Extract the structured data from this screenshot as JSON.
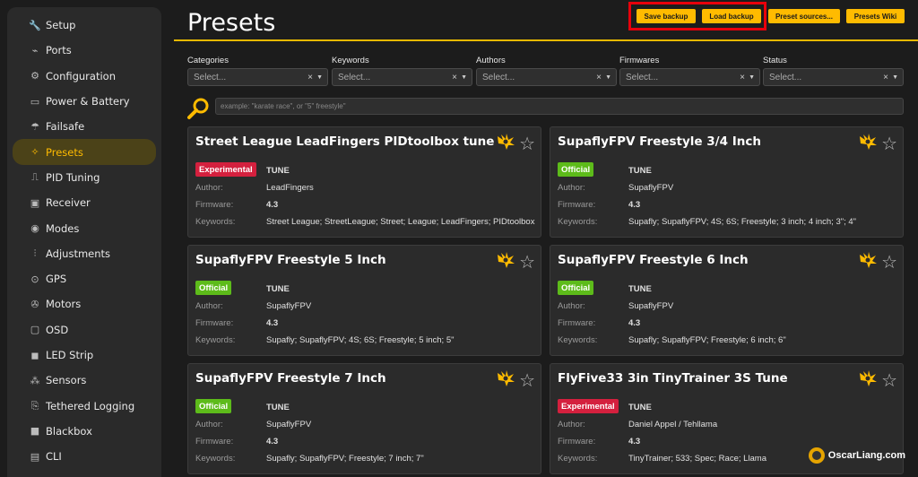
{
  "sidebar": {
    "items": [
      {
        "label": "Setup",
        "icon": "wrench-icon",
        "glyph": "🔧"
      },
      {
        "label": "Ports",
        "icon": "plug-icon",
        "glyph": "⌁"
      },
      {
        "label": "Configuration",
        "icon": "gear-icon",
        "glyph": "⚙"
      },
      {
        "label": "Power & Battery",
        "icon": "battery-icon",
        "glyph": "▭"
      },
      {
        "label": "Failsafe",
        "icon": "parachute-icon",
        "glyph": "☂"
      },
      {
        "label": "Presets",
        "icon": "magic-wand-icon",
        "glyph": "✧",
        "active": true
      },
      {
        "label": "PID Tuning",
        "icon": "pid-icon",
        "glyph": "⎍"
      },
      {
        "label": "Receiver",
        "icon": "receiver-icon",
        "glyph": "▣"
      },
      {
        "label": "Modes",
        "icon": "toggle-icon",
        "glyph": "◉"
      },
      {
        "label": "Adjustments",
        "icon": "sliders-icon",
        "glyph": "⫶"
      },
      {
        "label": "GPS",
        "icon": "location-pin-icon",
        "glyph": "⊙"
      },
      {
        "label": "Motors",
        "icon": "motor-icon",
        "glyph": "✇"
      },
      {
        "label": "OSD",
        "icon": "monitor-icon",
        "glyph": "▢"
      },
      {
        "label": "LED Strip",
        "icon": "led-icon",
        "glyph": "◼"
      },
      {
        "label": "Sensors",
        "icon": "sensor-icon",
        "glyph": "⁂"
      },
      {
        "label": "Tethered Logging",
        "icon": "cable-icon",
        "glyph": "⎘"
      },
      {
        "label": "Blackbox",
        "icon": "blackbox-icon",
        "glyph": "■"
      },
      {
        "label": "CLI",
        "icon": "terminal-icon",
        "glyph": "▤"
      }
    ]
  },
  "header": {
    "title": "Presets",
    "buttons": {
      "save_backup": "Save backup",
      "load_backup": "Load backup",
      "preset_sources": "Preset sources...",
      "presets_wiki": "Presets Wiki"
    }
  },
  "filters": [
    {
      "label": "Categories",
      "placeholder": "Select..."
    },
    {
      "label": "Keywords",
      "placeholder": "Select..."
    },
    {
      "label": "Authors",
      "placeholder": "Select..."
    },
    {
      "label": "Firmwares",
      "placeholder": "Select..."
    },
    {
      "label": "Status",
      "placeholder": "Select..."
    }
  ],
  "search": {
    "placeholder": "example: \"karate race\", or \"5\" freestyle\""
  },
  "labels": {
    "author": "Author:",
    "firmware": "Firmware:",
    "keywords": "Keywords:"
  },
  "cards": [
    {
      "title": "Street League LeadFingers PIDtoolbox tune",
      "status": "Experimental",
      "type": "TUNE",
      "author": "LeadFingers",
      "firmware": "4.3",
      "keywords": "Street League; StreetLeague; Street; League; LeadFingers; PIDtoolbox"
    },
    {
      "title": "SupaflyFPV Freestyle 3/4 Inch",
      "status": "Official",
      "type": "TUNE",
      "author": "SupaflyFPV",
      "firmware": "4.3",
      "keywords": "Supafly; SupaflyFPV; 4S; 6S; Freestyle; 3 inch; 4 inch; 3\"; 4\""
    },
    {
      "title": "SupaflyFPV Freestyle 5 Inch",
      "status": "Official",
      "type": "TUNE",
      "author": "SupaflyFPV",
      "firmware": "4.3",
      "keywords": "Supafly; SupaflyFPV; 4S; 6S; Freestyle; 5 inch; 5\""
    },
    {
      "title": "SupaflyFPV Freestyle 6 Inch",
      "status": "Official",
      "type": "TUNE",
      "author": "SupaflyFPV",
      "firmware": "4.3",
      "keywords": "Supafly; SupaflyFPV; Freestyle; 6 inch; 6\""
    },
    {
      "title": "SupaflyFPV Freestyle 7 Inch",
      "status": "Official",
      "type": "TUNE",
      "author": "SupaflyFPV",
      "firmware": "4.3",
      "keywords": "Supafly; SupaflyFPV; Freestyle; 7 inch; 7\""
    },
    {
      "title": "FlyFive33 3in TinyTrainer 3S Tune",
      "status": "Experimental",
      "type": "TUNE",
      "author": "Daniel Appel / Tehllama",
      "firmware": "4.3",
      "keywords": "TinyTrainer; 533; Spec; Race; Llama"
    }
  ],
  "watermark": {
    "text": "OscarLiang.com"
  },
  "colors": {
    "accent": "#ffbb00",
    "experimental": "#d4203e",
    "official": "#5dbb1a",
    "highlight": "#e8000b"
  }
}
